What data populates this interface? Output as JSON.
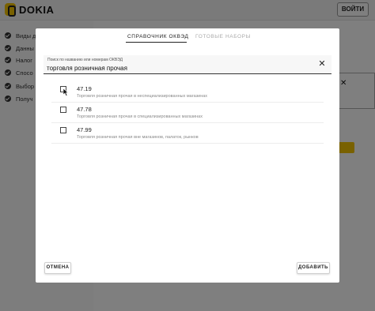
{
  "app": {
    "brand": "DOKIA",
    "login_label": "ВОЙТИ",
    "brand_color": "#f2c200"
  },
  "sidebar": {
    "items": [
      {
        "label": "Виды д"
      },
      {
        "label": "Данны"
      },
      {
        "label": "Налог"
      },
      {
        "label": "Спосо"
      },
      {
        "label": "Выбор"
      },
      {
        "label": "Получ"
      }
    ]
  },
  "modal": {
    "tabs": [
      {
        "label": "СПРАВОЧНИК ОКВЭД",
        "active": true
      },
      {
        "label": "ГОТОВЫЕ НАБОРЫ",
        "active": false
      }
    ],
    "search": {
      "label": "Поиск по названию или номерам ОКВЭД",
      "value": "торговля розничная прочая"
    },
    "results": [
      {
        "code": "47.19",
        "description": "Торговля розничная прочая в неспециализированных магазинах",
        "checked": false
      },
      {
        "code": "47.78",
        "description": "Торговля розничная прочая в специализированных магазинах",
        "checked": false
      },
      {
        "code": "47.99",
        "description": "Торговля розничная прочая вне магазинов, палаток, рынков",
        "checked": false
      }
    ],
    "cancel_label": "ОТМЕНА",
    "add_label": "ДОБАВИТЬ"
  }
}
